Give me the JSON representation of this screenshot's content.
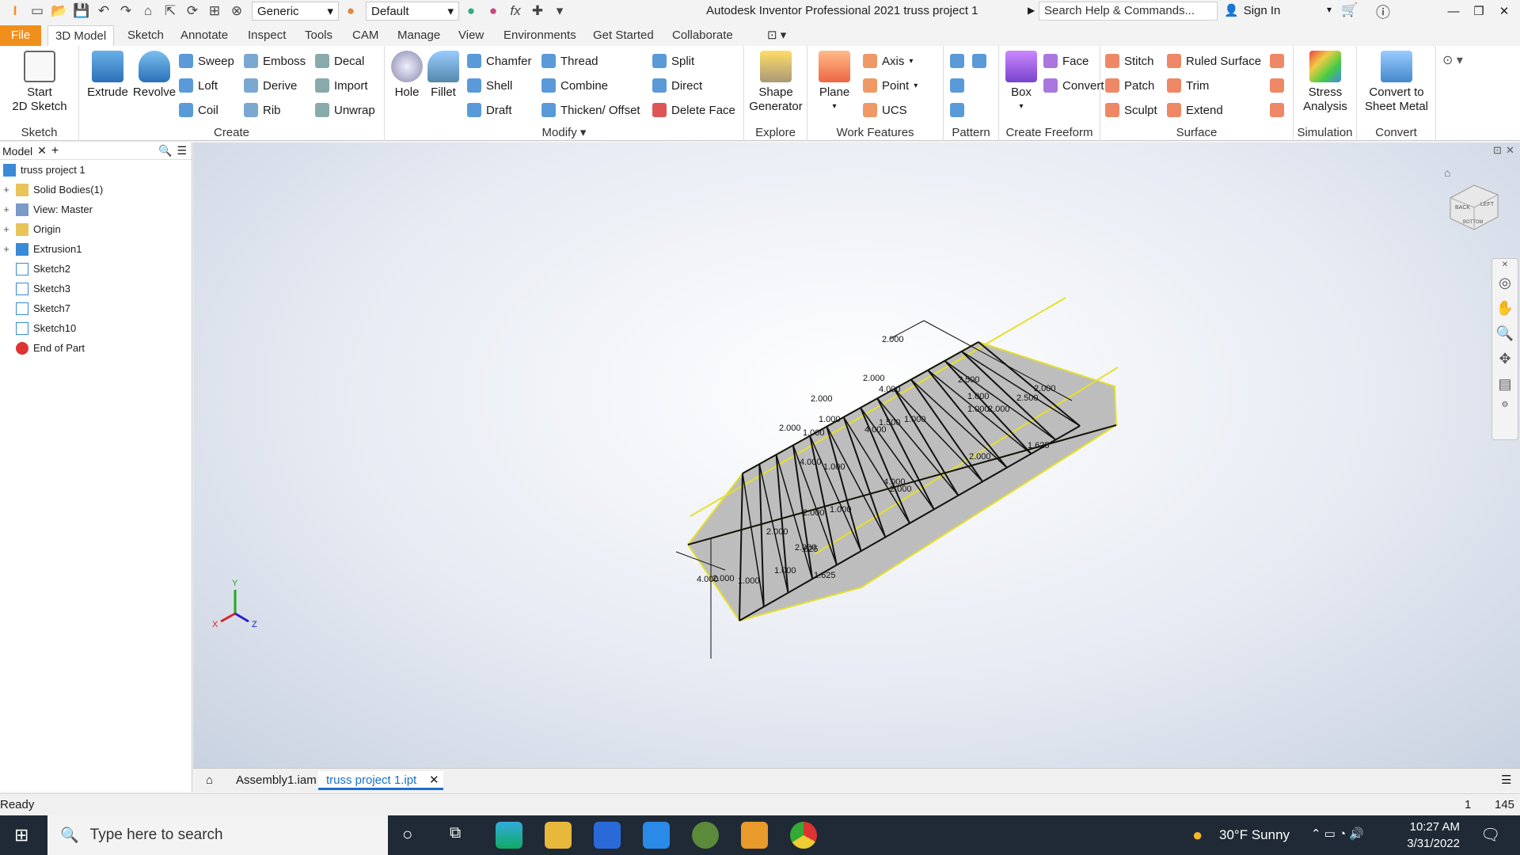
{
  "title_bar": {
    "app_title": "Autodesk Inventor Professional 2021    truss project 1",
    "material": "Generic",
    "appearance": "Default",
    "search_placeholder": "Search Help & Commands...",
    "sign_in": "Sign In"
  },
  "tabs": [
    "File",
    "3D Model",
    "Sketch",
    "Annotate",
    "Inspect",
    "Tools",
    "CAM",
    "Manage",
    "View",
    "Environments",
    "Get Started",
    "Collaborate"
  ],
  "ribbon": {
    "sketch": {
      "label": "Sketch",
      "start": "Start",
      "start2": "2D Sketch"
    },
    "create": {
      "label": "Create",
      "extrude": "Extrude",
      "revolve": "Revolve",
      "sweep": "Sweep",
      "loft": "Loft",
      "coil": "Coil",
      "emboss": "Emboss",
      "derive": "Derive",
      "rib": "Rib",
      "decal": "Decal",
      "import": "Import",
      "unwrap": "Unwrap"
    },
    "modify": {
      "label": "Modify",
      "hole": "Hole",
      "fillet": "Fillet",
      "chamfer": "Chamfer",
      "shell": "Shell",
      "draft": "Draft",
      "thread": "Thread",
      "combine": "Combine",
      "thicken": "Thicken/ Offset",
      "split": "Split",
      "direct": "Direct",
      "delete_face": "Delete Face"
    },
    "explore": {
      "label": "Explore",
      "shape1": "Shape",
      "shape2": "Generator"
    },
    "work": {
      "label": "Work Features",
      "plane": "Plane",
      "axis": "Axis",
      "point": "Point",
      "ucs": "UCS"
    },
    "pattern": {
      "label": "Pattern"
    },
    "freeform": {
      "label": "Create Freeform",
      "box": "Box",
      "face": "Face",
      "convert": "Convert"
    },
    "surface": {
      "label": "Surface",
      "stitch": "Stitch",
      "patch": "Patch",
      "sculpt": "Sculpt",
      "ruled": "Ruled Surface",
      "trim": "Trim",
      "extend": "Extend"
    },
    "simulation": {
      "label": "Simulation",
      "stress1": "Stress",
      "stress2": "Analysis"
    },
    "convert": {
      "label": "Convert",
      "c1": "Convert to",
      "c2": "Sheet Metal"
    }
  },
  "browser": {
    "tab": "Model",
    "items": [
      "truss project 1",
      "Solid Bodies(1)",
      "View: Master",
      "Origin",
      "Extrusion1",
      "Sketch2",
      "Sketch3",
      "Sketch7",
      "Sketch10",
      "End of Part"
    ]
  },
  "viewcube": {
    "back": "BACK",
    "left": "LEFT",
    "bottom": "BOTTOM"
  },
  "dims": [
    "2.000",
    "2.000",
    "4.000",
    "2.000",
    "2.000",
    "1.000",
    "1.000",
    "4.000",
    "1.500",
    "1.000",
    "2.500",
    "1.000",
    "1.000",
    "2.000",
    "2.500",
    "2.000",
    "1.625",
    "4.000",
    "2.000",
    "2.000",
    "1.000",
    "4.000",
    "1.000",
    "2.000",
    "2.000",
    ".625",
    "1.000",
    "1.000",
    "1.625",
    "4.000",
    "2.000",
    "2.000"
  ],
  "doc_tabs": [
    "Assembly1.iam",
    "truss project 1.ipt"
  ],
  "status": {
    "text": "Ready",
    "n1": "1",
    "n2": "145"
  },
  "taskbar": {
    "search": "Type here to search",
    "weather": "30°F  Sunny",
    "time": "10:27 AM",
    "date": "3/31/2022"
  }
}
